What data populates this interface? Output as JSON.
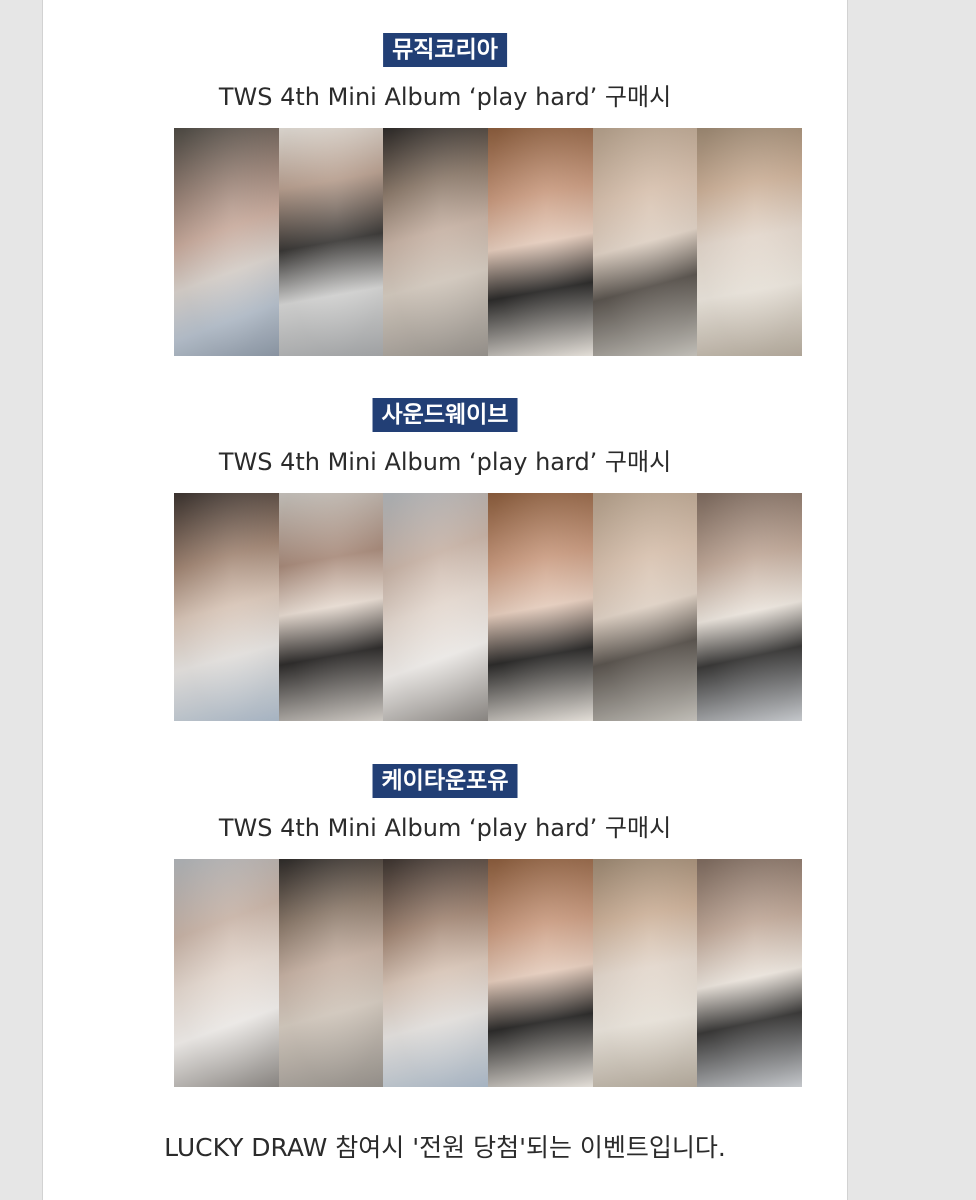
{
  "sections": [
    {
      "shop": "뮤직코리아",
      "description": "TWS 4th Mini Album ‘play hard’ 구매시"
    },
    {
      "shop": "사운드웨이브",
      "description": "TWS 4th Mini Album ‘play hard’ 구매시"
    },
    {
      "shop": "케이타운포유",
      "description": "TWS 4th Mini Album ‘play hard’ 구매시"
    }
  ],
  "footer": {
    "note": "LUCKY DRAW 참여시 '전원 당첨'되는 이벤트입니다."
  }
}
